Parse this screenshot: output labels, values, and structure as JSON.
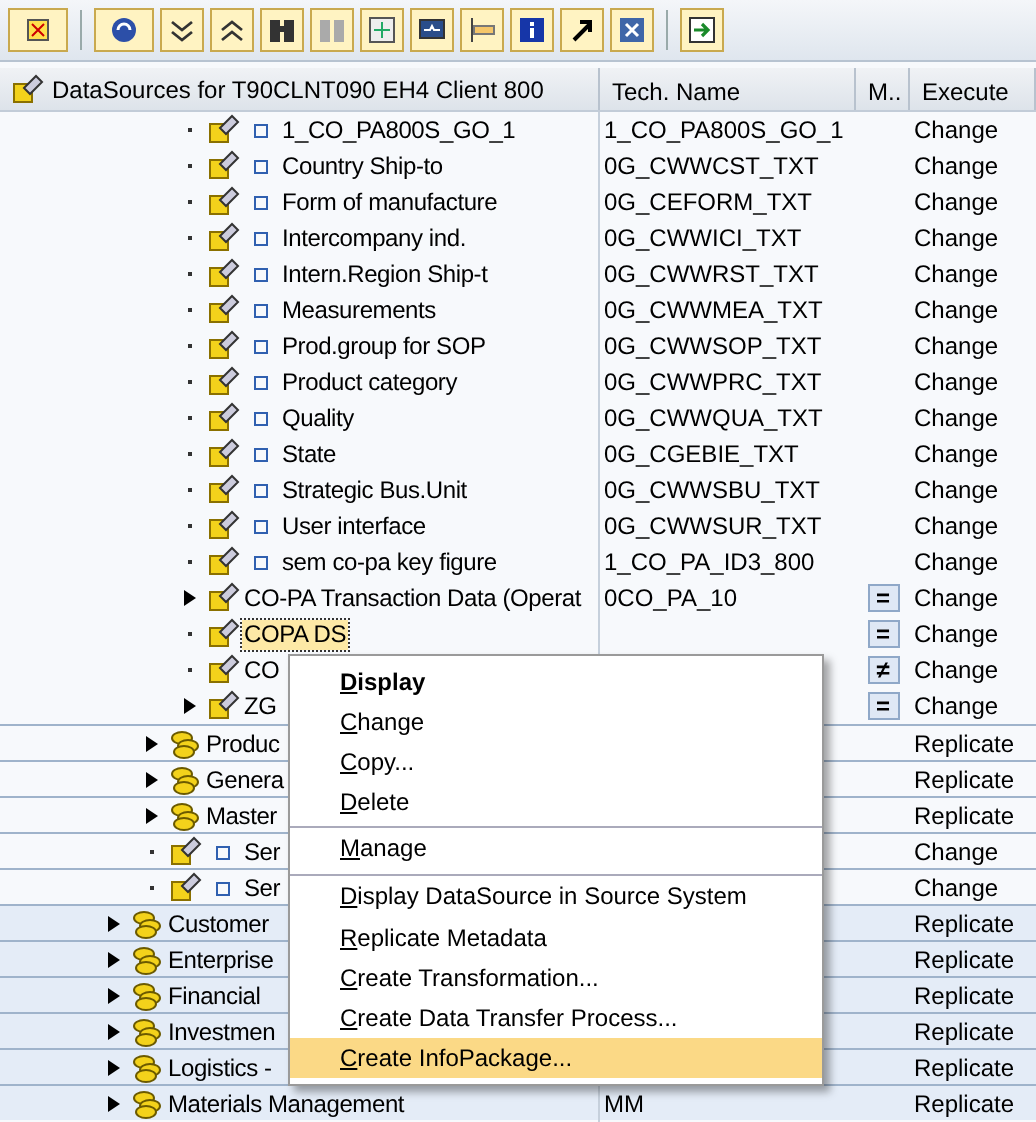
{
  "header": {
    "title": "DataSources for T90CLNT090 EH4 Client 800",
    "columns": [
      "Tech. Name",
      "M..",
      "Execute"
    ]
  },
  "tree": [
    {
      "children": [
        {
          "children": [
            {
              "label": "1_CO_PA800S_GO_1",
              "kind": "datasource",
              "expandable": false,
              "object_marker": true,
              "selected": false,
              "tech": "1_CO_PA800S_GO_1",
              "action": "Change"
            },
            {
              "label": "Country Ship-to",
              "kind": "datasource",
              "expandable": false,
              "object_marker": true,
              "selected": false,
              "tech": "0G_CWWCST_TXT",
              "action": "Change"
            },
            {
              "label": "Form of manufacture",
              "kind": "datasource",
              "expandable": false,
              "object_marker": true,
              "selected": false,
              "tech": "0G_CEFORM_TXT",
              "action": "Change"
            },
            {
              "label": "Intercompany ind.",
              "kind": "datasource",
              "expandable": false,
              "object_marker": true,
              "selected": false,
              "tech": "0G_CWWICI_TXT",
              "action": "Change"
            },
            {
              "label": "Intern.Region Ship-t",
              "kind": "datasource",
              "expandable": false,
              "object_marker": true,
              "selected": false,
              "tech": "0G_CWWRST_TXT",
              "action": "Change"
            },
            {
              "label": "Measurements",
              "kind": "datasource",
              "expandable": false,
              "object_marker": true,
              "selected": false,
              "tech": "0G_CWWMEA_TXT",
              "action": "Change"
            },
            {
              "label": "Prod.group for SOP",
              "kind": "datasource",
              "expandable": false,
              "object_marker": true,
              "selected": false,
              "tech": "0G_CWWSOP_TXT",
              "action": "Change"
            },
            {
              "label": "Product category",
              "kind": "datasource",
              "expandable": false,
              "object_marker": true,
              "selected": false,
              "tech": "0G_CWWPRC_TXT",
              "action": "Change"
            },
            {
              "label": "Quality",
              "kind": "datasource",
              "expandable": false,
              "object_marker": true,
              "selected": false,
              "tech": "0G_CWWQUA_TXT",
              "action": "Change"
            },
            {
              "label": "State",
              "kind": "datasource",
              "expandable": false,
              "object_marker": true,
              "selected": false,
              "tech": "0G_CGEBIE_TXT",
              "action": "Change"
            },
            {
              "label": "Strategic Bus.Unit",
              "kind": "datasource",
              "expandable": false,
              "object_marker": true,
              "selected": false,
              "tech": "0G_CWWSBU_TXT",
              "action": "Change"
            },
            {
              "label": "User interface",
              "kind": "datasource",
              "expandable": false,
              "object_marker": true,
              "selected": false,
              "tech": "0G_CWWSUR_TXT",
              "action": "Change"
            },
            {
              "label": "sem co-pa key figure",
              "kind": "datasource",
              "expandable": false,
              "object_marker": true,
              "selected": false,
              "tech": "1_CO_PA_ID3_800",
              "action": "Change"
            },
            {
              "label": "CO-PA Transaction Data (Operat",
              "kind": "datasource",
              "expandable": true,
              "object_marker": false,
              "selected": false,
              "tech": "0CO_PA_10",
              "match": "=",
              "action": "Change"
            },
            {
              "label": "COPA DS",
              "kind": "datasource",
              "expandable": false,
              "object_marker": false,
              "selected": true,
              "match": "=",
              "action": "Change"
            },
            {
              "label": "CO",
              "kind": "datasource",
              "expandable": false,
              "object_marker": false,
              "selected": false,
              "match": "≠",
              "action": "Change"
            },
            {
              "label": "ZG",
              "kind": "datasource",
              "expandable": true,
              "object_marker": false,
              "selected": false,
              "match": "=",
              "action": "Change"
            }
          ]
        },
        {
          "label": "Produc",
          "kind": "component",
          "expandable": true,
          "object_marker": false,
          "selected": false,
          "action": "Replicate"
        },
        {
          "label": "Genera",
          "kind": "component",
          "expandable": true,
          "object_marker": false,
          "selected": false,
          "action": "Replicate"
        },
        {
          "label": "Master",
          "kind": "component",
          "expandable": true,
          "object_marker": false,
          "selected": false,
          "action": "Replicate"
        },
        {
          "label": "Ser",
          "kind": "datasource",
          "expandable": false,
          "object_marker": true,
          "selected": false,
          "action": "Change"
        },
        {
          "label": "Ser",
          "kind": "datasource",
          "expandable": false,
          "object_marker": true,
          "selected": false,
          "action": "Change"
        }
      ]
    },
    {
      "label": "Customer",
      "kind": "component",
      "expandable": true,
      "object_marker": false,
      "selected": false,
      "action": "Replicate"
    },
    {
      "label": "Enterprise",
      "kind": "component",
      "expandable": true,
      "object_marker": false,
      "selected": false,
      "action": "Replicate"
    },
    {
      "label": "Financial",
      "kind": "component",
      "expandable": true,
      "object_marker": false,
      "selected": false,
      "action": "Replicate"
    },
    {
      "label": "Investmen",
      "kind": "component",
      "expandable": true,
      "object_marker": false,
      "selected": false,
      "action": "Replicate"
    },
    {
      "label": "Logistics -",
      "kind": "component",
      "expandable": true,
      "object_marker": false,
      "selected": false,
      "action": "Replicate"
    },
    {
      "label": "Materials Management",
      "kind": "component",
      "expandable": true,
      "object_marker": false,
      "selected": false,
      "tech": "MM",
      "action": "Replicate"
    }
  ],
  "context_menu": [
    {
      "label": "Display",
      "default": true,
      "highlighted": false,
      "separator_before": false
    },
    {
      "label": "Change",
      "default": false,
      "highlighted": false,
      "separator_before": false
    },
    {
      "label": "Copy...",
      "default": false,
      "highlighted": false,
      "separator_before": false
    },
    {
      "label": "Delete",
      "default": false,
      "highlighted": false,
      "separator_before": false
    },
    {
      "label": "Manage",
      "default": false,
      "highlighted": false,
      "separator_before": true
    },
    {
      "label": "Display DataSource in Source System",
      "default": false,
      "highlighted": false,
      "separator_before": true
    },
    {
      "label": "Replicate Metadata",
      "default": false,
      "highlighted": false,
      "separator_before": false
    },
    {
      "label": "Create Transformation...",
      "default": false,
      "highlighted": false,
      "separator_before": false
    },
    {
      "label": "Create Data Transfer Process...",
      "default": false,
      "highlighted": false,
      "separator_before": false
    },
    {
      "label": "Create InfoPackage...",
      "default": false,
      "highlighted": true,
      "separator_before": false
    }
  ]
}
